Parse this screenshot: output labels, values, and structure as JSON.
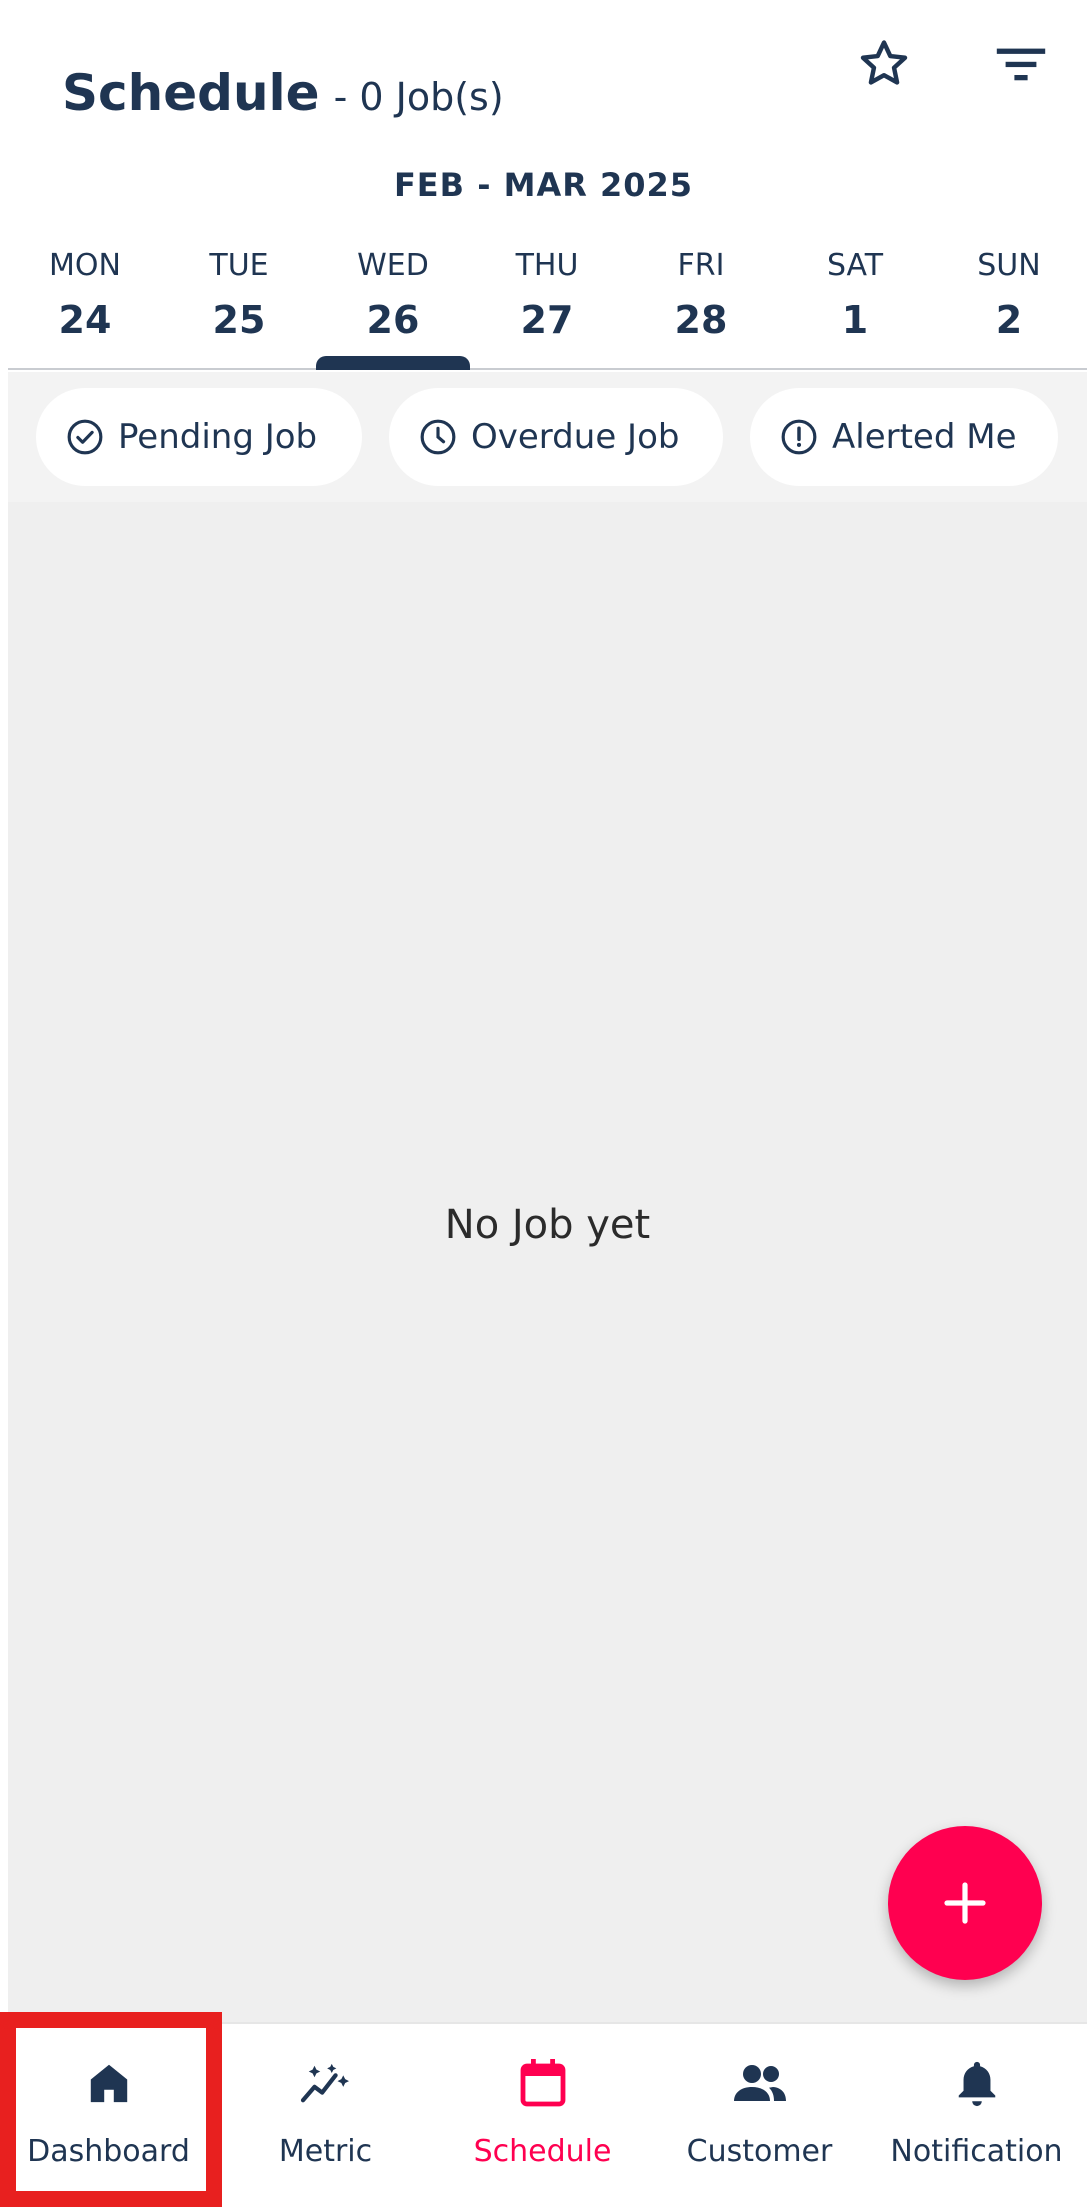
{
  "header": {
    "title": "Schedule",
    "subtitle": "- 0 Job(s)",
    "icons": [
      "star-icon",
      "filter-icon"
    ]
  },
  "month_label": "FEB - MAR 2025",
  "week": [
    {
      "name": "MON",
      "num": "24",
      "selected": false
    },
    {
      "name": "TUE",
      "num": "25",
      "selected": false
    },
    {
      "name": "WED",
      "num": "26",
      "selected": true
    },
    {
      "name": "THU",
      "num": "27",
      "selected": false
    },
    {
      "name": "FRI",
      "num": "28",
      "selected": false
    },
    {
      "name": "SAT",
      "num": "1",
      "selected": false
    },
    {
      "name": "SUN",
      "num": "2",
      "selected": false
    }
  ],
  "chips": [
    {
      "label": "Pending Job",
      "icon": "check-circle-icon"
    },
    {
      "label": "Overdue Job",
      "icon": "clock-icon"
    },
    {
      "label": "Alerted Me",
      "icon": "alert-circle-icon"
    }
  ],
  "empty_message": "No Job yet",
  "fab": {
    "icon": "plus-icon",
    "color": "#ff0050"
  },
  "nav": [
    {
      "label": "Dashboard",
      "icon": "home-icon",
      "active": false
    },
    {
      "label": "Metric",
      "icon": "sparkle-chart-icon",
      "active": false
    },
    {
      "label": "Schedule",
      "icon": "calendar-icon",
      "active": true
    },
    {
      "label": "Customer",
      "icon": "people-icon",
      "active": false
    },
    {
      "label": "Notification",
      "icon": "bell-icon",
      "active": false
    }
  ],
  "colors": {
    "primary": "#1f3552",
    "accent": "#ff0050",
    "highlight_box": "#e8201f",
    "background": "#efefef"
  }
}
